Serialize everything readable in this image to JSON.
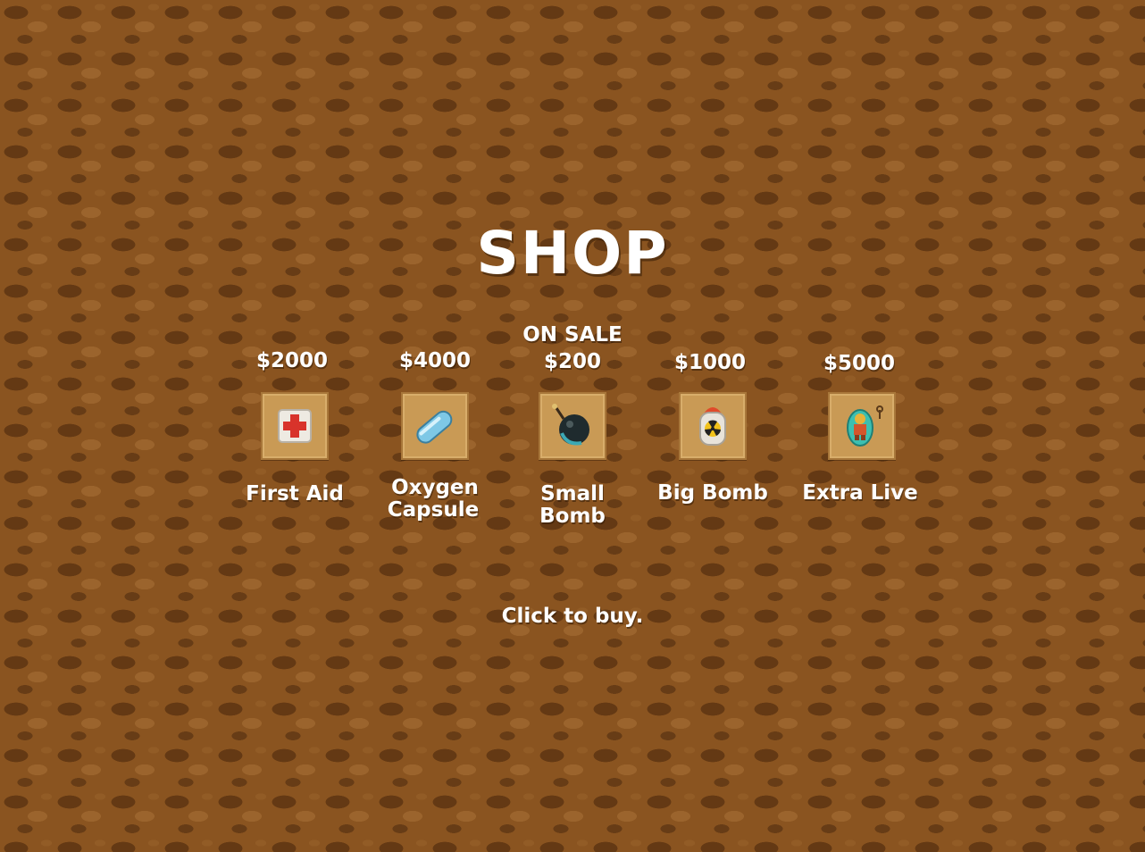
{
  "title": "SHOP",
  "items": [
    {
      "price": "$2000",
      "name": "First Aid",
      "icon": "first-aid-icon"
    },
    {
      "price": "$4000",
      "name_line1": "Oxygen",
      "name_line2": "Capsule",
      "icon": "oxygen-capsule-icon"
    },
    {
      "sale_tag": "ON SALE",
      "price": "$200",
      "name": "Small Bomb",
      "icon": "small-bomb-icon"
    },
    {
      "price": "$1000",
      "name": "Big Bomb",
      "icon": "big-bomb-icon"
    },
    {
      "price": "$5000",
      "name": "Extra Live",
      "icon": "extra-life-icon"
    }
  ],
  "hint": "Click to buy."
}
